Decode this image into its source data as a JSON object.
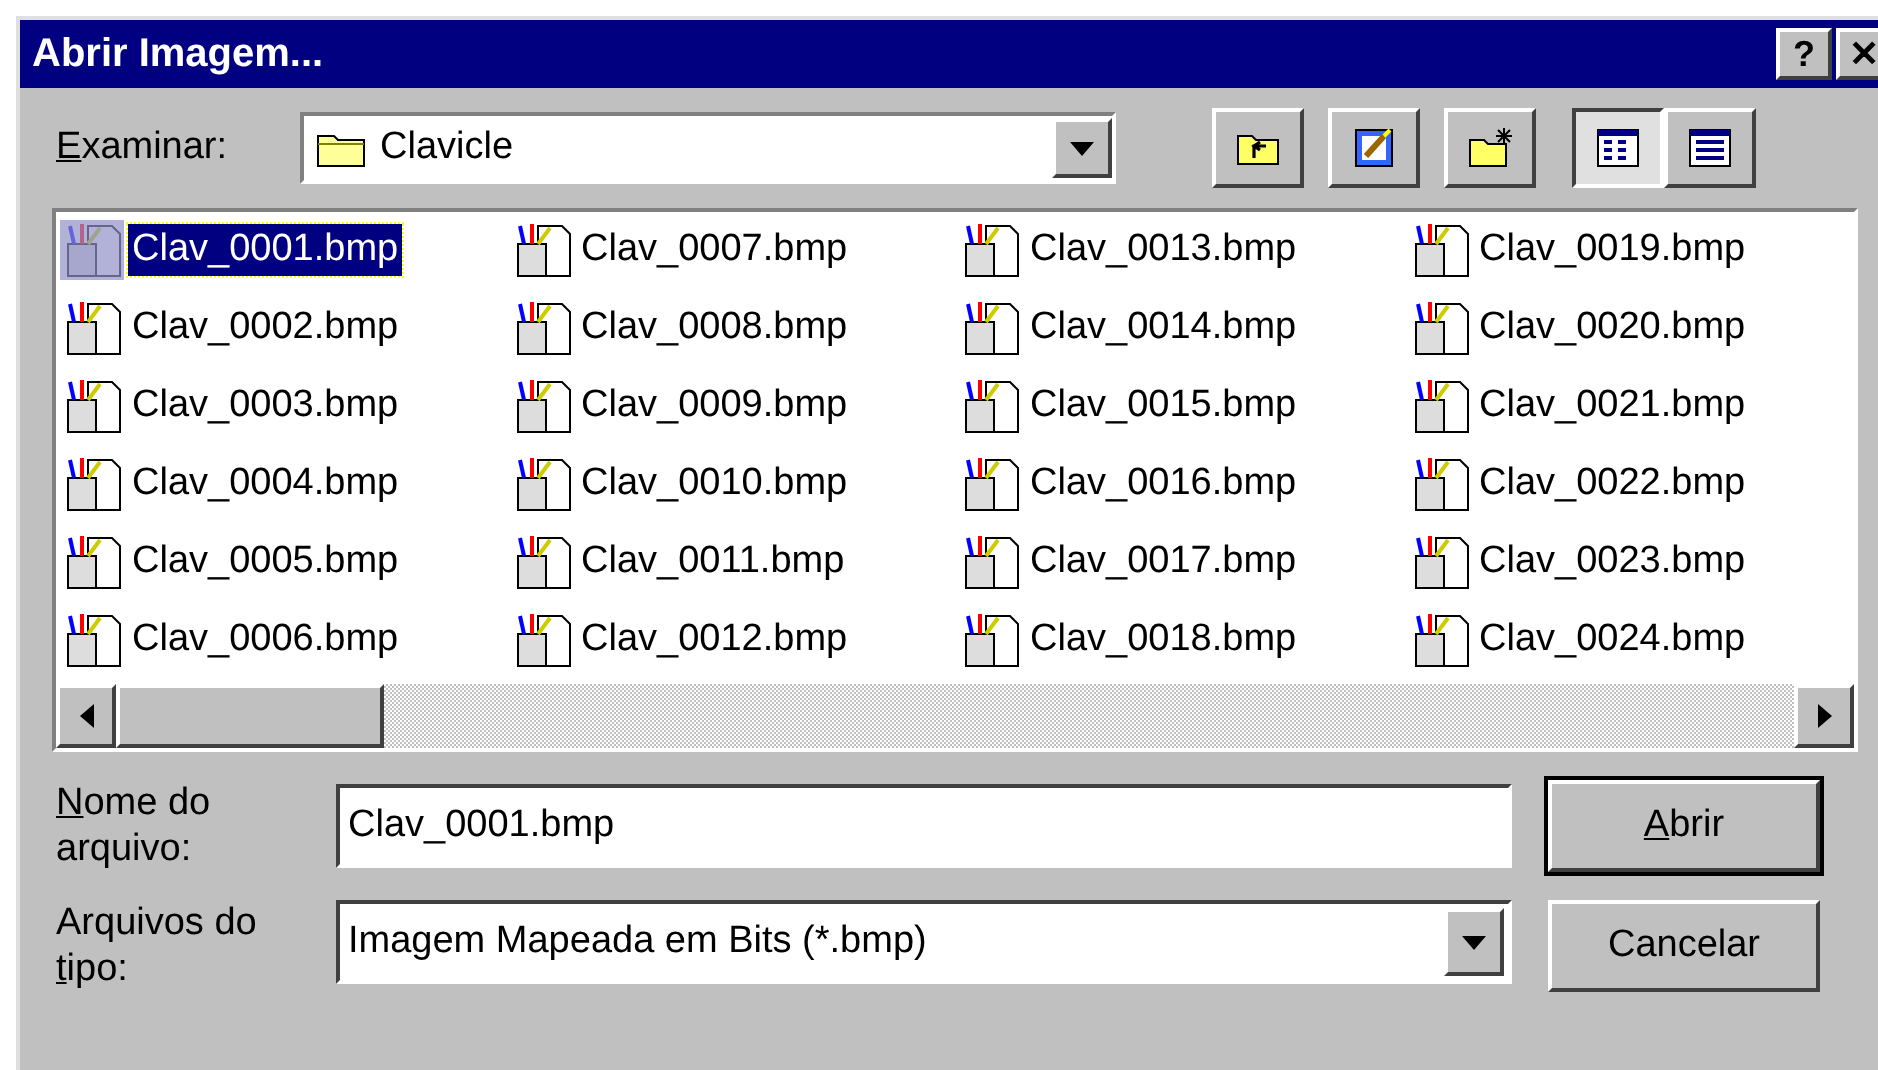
{
  "window": {
    "title": "Abrir Imagem...",
    "buttons": [
      "?",
      "✕"
    ]
  },
  "look_in": {
    "label": {
      "accel": "E",
      "after": "xaminar:"
    },
    "value": "Clavicle"
  },
  "toolbar": [
    {
      "kind": "up",
      "selected": false
    },
    {
      "kind": "desktop",
      "selected": false
    },
    {
      "kind": "newfolder",
      "selected": false
    },
    {
      "kind": "list",
      "selected": true
    },
    {
      "kind": "details",
      "selected": false
    }
  ],
  "files": [
    {
      "name": "Clav_0001.bmp",
      "selected": true
    },
    {
      "name": "Clav_0002.bmp",
      "selected": false
    },
    {
      "name": "Clav_0003.bmp",
      "selected": false
    },
    {
      "name": "Clav_0004.bmp",
      "selected": false
    },
    {
      "name": "Clav_0005.bmp",
      "selected": false
    },
    {
      "name": "Clav_0006.bmp",
      "selected": false
    },
    {
      "name": "Clav_0007.bmp",
      "selected": false
    },
    {
      "name": "Clav_0008.bmp",
      "selected": false
    },
    {
      "name": "Clav_0009.bmp",
      "selected": false
    },
    {
      "name": "Clav_0010.bmp",
      "selected": false
    },
    {
      "name": "Clav_0011.bmp",
      "selected": false
    },
    {
      "name": "Clav_0012.bmp",
      "selected": false
    },
    {
      "name": "Clav_0013.bmp",
      "selected": false
    },
    {
      "name": "Clav_0014.bmp",
      "selected": false
    },
    {
      "name": "Clav_0015.bmp",
      "selected": false
    },
    {
      "name": "Clav_0016.bmp",
      "selected": false
    },
    {
      "name": "Clav_0017.bmp",
      "selected": false
    },
    {
      "name": "Clav_0018.bmp",
      "selected": false
    },
    {
      "name": "Clav_0019.bmp",
      "selected": false
    },
    {
      "name": "Clav_0020.bmp",
      "selected": false
    },
    {
      "name": "Clav_0021.bmp",
      "selected": false
    },
    {
      "name": "Clav_0022.bmp",
      "selected": false
    },
    {
      "name": "Clav_0023.bmp",
      "selected": false
    },
    {
      "name": "Clav_0024.bmp",
      "selected": false
    }
  ],
  "file_name": {
    "label": {
      "accel": "N",
      "after": "ome do arquivo:"
    },
    "value": "Clav_0001.bmp"
  },
  "file_type": {
    "label": {
      "before": "Arquivos do ",
      "accel": "t",
      "after": "ipo:"
    },
    "value": "Imagem Mapeada em Bits (*.bmp)"
  },
  "buttons": [
    {
      "kind": "default",
      "label": {
        "accel": "A",
        "after": "brir"
      }
    },
    {
      "kind": "normal",
      "label": {
        "after": "Cancelar"
      }
    }
  ]
}
